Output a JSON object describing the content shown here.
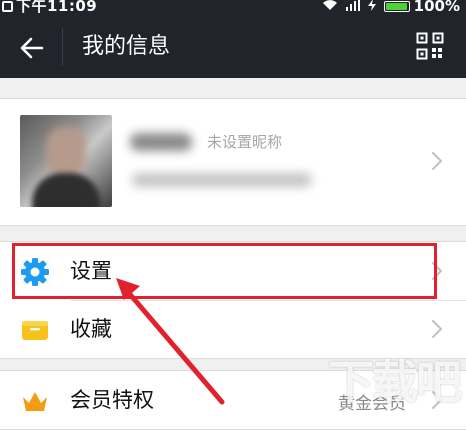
{
  "status_bar": {
    "time": "下午11:09",
    "battery": "100%",
    "icons": [
      "notification-icon",
      "wifi-icon",
      "signal-icon",
      "charging-icon",
      "battery-icon"
    ]
  },
  "header": {
    "title": "我的信息",
    "back_icon": "arrow-left-icon",
    "qr_icon": "qr-code-icon"
  },
  "profile": {
    "nickname": "未设置昵称"
  },
  "menu": {
    "group1": [
      {
        "label": "设置",
        "icon": "gear-icon"
      },
      {
        "label": "收藏",
        "icon": "folder-icon"
      }
    ],
    "group2": [
      {
        "label": "会员特权",
        "value": "黄金会员",
        "icon": "crown-icon"
      }
    ]
  },
  "watermark": "下载吧",
  "colors": {
    "header_bg": "#22242b",
    "accent_blue": "#1d9bf0",
    "folder_yellow": "#f7c21a",
    "crown_orange": "#f39c12",
    "annotation_red": "#e0212e"
  }
}
